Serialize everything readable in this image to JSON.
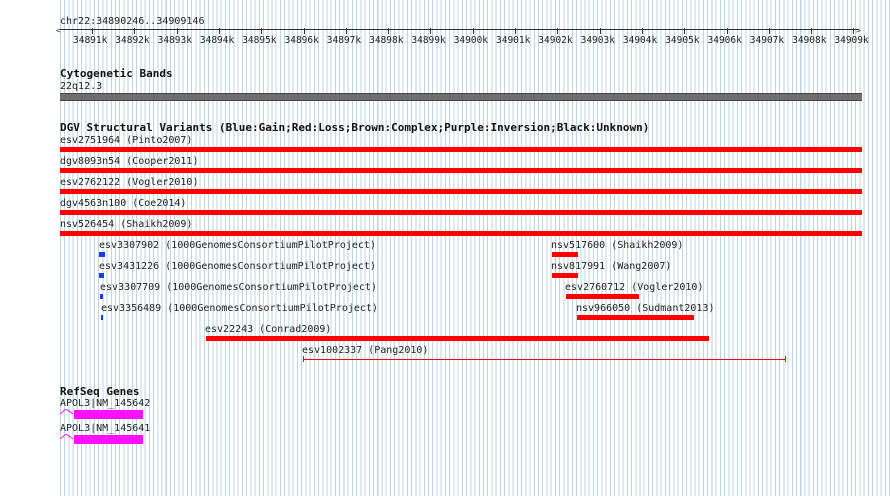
{
  "coords": "chr22:34890246..34909146",
  "ruler_ticks": [
    "34891k",
    "34892k",
    "34893k",
    "34894k",
    "34895k",
    "34896k",
    "34897k",
    "34898k",
    "34899k",
    "34900k",
    "34901k",
    "34902k",
    "34903k",
    "34904k",
    "34905k",
    "34906k",
    "34907k",
    "34908k",
    "34909k"
  ],
  "cytoband": {
    "title": "Cytogenetic Bands",
    "band": "22q12.3"
  },
  "dgv": {
    "title": "DGV Structural Variants (Blue:Gain;Red:Loss;Brown:Complex;Purple:Inversion;Black:Unknown)",
    "full_tracks": [
      {
        "label": "esv2751964 (Pinto2007)"
      },
      {
        "label": "dgv8093n54 (Cooper2011)"
      },
      {
        "label": "esv2762122 (Vogler2010)"
      },
      {
        "label": "dgv4563n100 (Coe2014)"
      },
      {
        "label": "nsv526454 (Shaikh2009)"
      }
    ],
    "variants": [
      {
        "label": "esv3307902 (1000GenomesConsortiumPilotProject)",
        "type": "gain"
      },
      {
        "label": "esv3431226 (1000GenomesConsortiumPilotProject)",
        "type": "gain"
      },
      {
        "label": "esv3307709 (1000GenomesConsortiumPilotProject)",
        "type": "gain"
      },
      {
        "label": "esv3356489 (1000GenomesConsortiumPilotProject)",
        "type": "gain"
      },
      {
        "label": "nsv517600 (Shaikh2009)",
        "type": "loss"
      },
      {
        "label": "nsv817991 (Wang2007)",
        "type": "loss"
      },
      {
        "label": "esv2760712 (Vogler2010)",
        "type": "loss"
      },
      {
        "label": "nsv966050 (Sudmant2013)",
        "type": "loss"
      },
      {
        "label": "esv22243 (Conrad2009)",
        "type": "loss"
      },
      {
        "label": "esv1002337 (Pang2010)",
        "type": "loss"
      }
    ]
  },
  "refseq": {
    "title": "RefSeq Genes",
    "genes": [
      {
        "label": "APOL3|NM_145642"
      },
      {
        "label": "APOL3|NM_145641"
      }
    ]
  },
  "colors": {
    "loss": "#ff0000",
    "gain": "#1a3cf0",
    "gene": "#ff10ff",
    "band": "#6e6e6e"
  }
}
